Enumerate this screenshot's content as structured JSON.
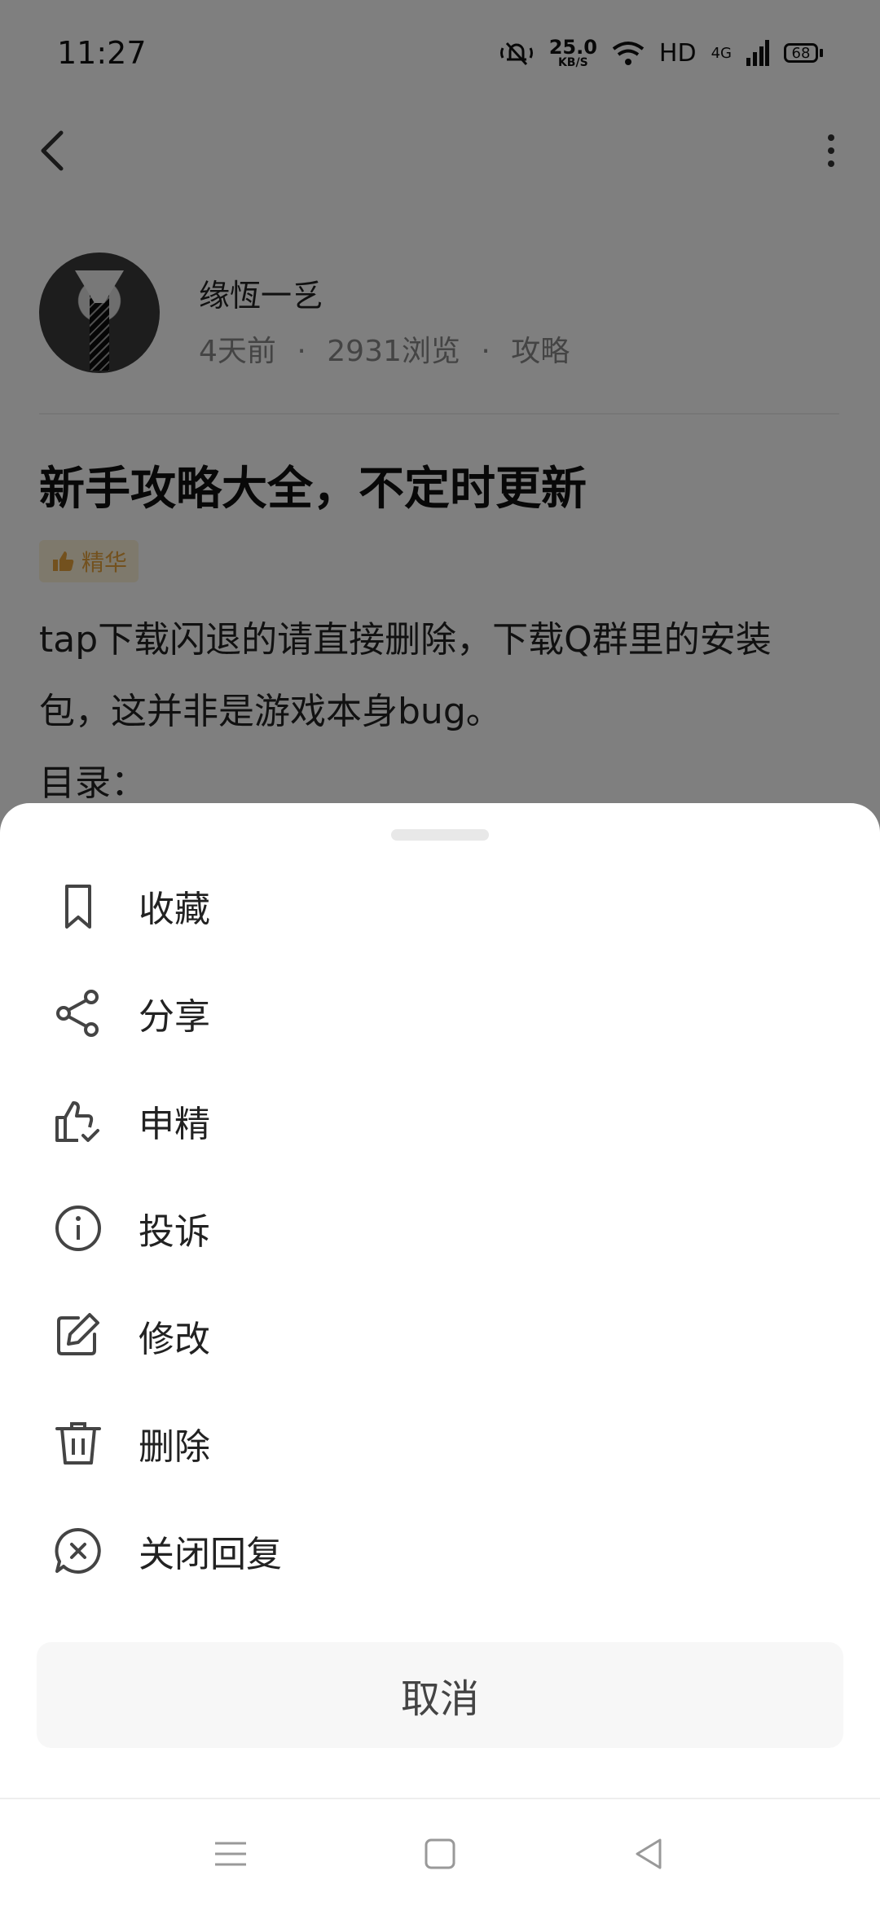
{
  "status_bar": {
    "time": "11:27",
    "net_speed_value": "25.0",
    "net_speed_unit": "KB/S",
    "hd": "HD",
    "network": "4G",
    "battery": "68"
  },
  "author": {
    "name": "缘恆一乥",
    "time": "4天前",
    "views": "2931浏览",
    "category": "攻略",
    "separator": "·"
  },
  "post": {
    "title": "新手攻略大全，不定时更新",
    "badge": "精华",
    "body_line1": "tap下载闪退的请直接删除，下载Q群里的安装",
    "body_line2": "包，这并非是游戏本身bug。",
    "body_line3": "目录："
  },
  "sheet": {
    "items": [
      {
        "label": "收藏",
        "icon": "bookmark-icon"
      },
      {
        "label": "分享",
        "icon": "share-icon"
      },
      {
        "label": "申精",
        "icon": "thumb-check-icon"
      },
      {
        "label": "投诉",
        "icon": "info-icon"
      },
      {
        "label": "修改",
        "icon": "edit-icon"
      },
      {
        "label": "删除",
        "icon": "trash-icon"
      },
      {
        "label": "关闭回复",
        "icon": "close-comment-icon"
      }
    ],
    "cancel": "取消"
  }
}
